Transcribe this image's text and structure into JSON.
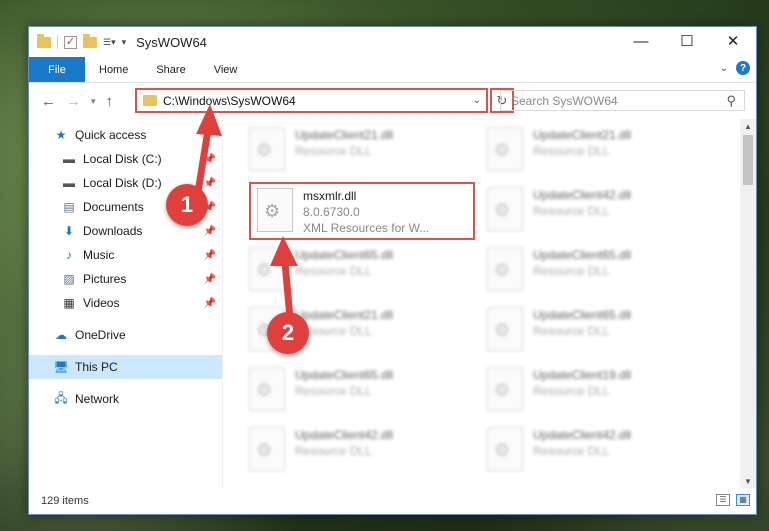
{
  "window": {
    "title": "SysWOW64",
    "controls": {
      "minimize": "—",
      "maximize": "☐",
      "close": "✕"
    }
  },
  "ribbon": {
    "tabs": [
      "File",
      "Home",
      "Share",
      "View"
    ],
    "help_label": "?",
    "expand_label": "⌄"
  },
  "address": {
    "path": "C:\\Windows\\SysWOW64",
    "search_placeholder": "Search SysWOW64"
  },
  "sidebar": {
    "items": [
      {
        "label": "Quick access",
        "icon": "star-icon",
        "pinned": false
      },
      {
        "label": "Local Disk (C:)",
        "icon": "drive-icon",
        "pinned": true
      },
      {
        "label": "Local Disk (D:)",
        "icon": "drive-icon",
        "pinned": true
      },
      {
        "label": "Documents",
        "icon": "documents-icon",
        "pinned": true
      },
      {
        "label": "Downloads",
        "icon": "downloads-icon",
        "pinned": true
      },
      {
        "label": "Music",
        "icon": "music-icon",
        "pinned": true
      },
      {
        "label": "Pictures",
        "icon": "pictures-icon",
        "pinned": true
      },
      {
        "label": "Videos",
        "icon": "videos-icon",
        "pinned": true
      },
      {
        "label": "OneDrive",
        "icon": "cloud-icon",
        "pinned": false
      },
      {
        "label": "This PC",
        "icon": "computer-icon",
        "pinned": false,
        "selected": true
      },
      {
        "label": "Network",
        "icon": "network-icon",
        "pinned": false
      }
    ]
  },
  "files": [
    {
      "name": "UpdateClient21.dll",
      "desc": "Resource DLL",
      "ver": ""
    },
    {
      "name": "UpdateClient21.dll",
      "desc": "Resource DLL",
      "ver": ""
    },
    {
      "name": "msxmlr.dll",
      "ver": "8.0.6730.0",
      "desc": "XML Resources for W..."
    },
    {
      "name": "UpdateClient42.dll",
      "desc": "Resource DLL",
      "ver": ""
    },
    {
      "name": "UpdateClient65.dll",
      "desc": "Resource DLL",
      "ver": ""
    },
    {
      "name": "UpdateClient65.dll",
      "desc": "Resource DLL",
      "ver": ""
    },
    {
      "name": "UpdateClient21.dll",
      "desc": "Resource DLL",
      "ver": ""
    },
    {
      "name": "UpdateClient65.dll",
      "desc": "Resource DLL",
      "ver": ""
    },
    {
      "name": "UpdateClient65.dll",
      "desc": "Resource DLL",
      "ver": ""
    },
    {
      "name": "UpdateClient19.dll",
      "desc": "Resource DLL",
      "ver": ""
    },
    {
      "name": "UpdateClient42.dll",
      "desc": "Resource DLL",
      "ver": ""
    },
    {
      "name": "UpdateClient42.dll",
      "desc": "Resource DLL",
      "ver": ""
    }
  ],
  "status": {
    "item_count": "129 items"
  },
  "annotations": {
    "step1": "1",
    "step2": "2"
  },
  "colors": {
    "accent": "#1979ca",
    "highlight": "#d9534f",
    "selected": "#cce8ff"
  }
}
